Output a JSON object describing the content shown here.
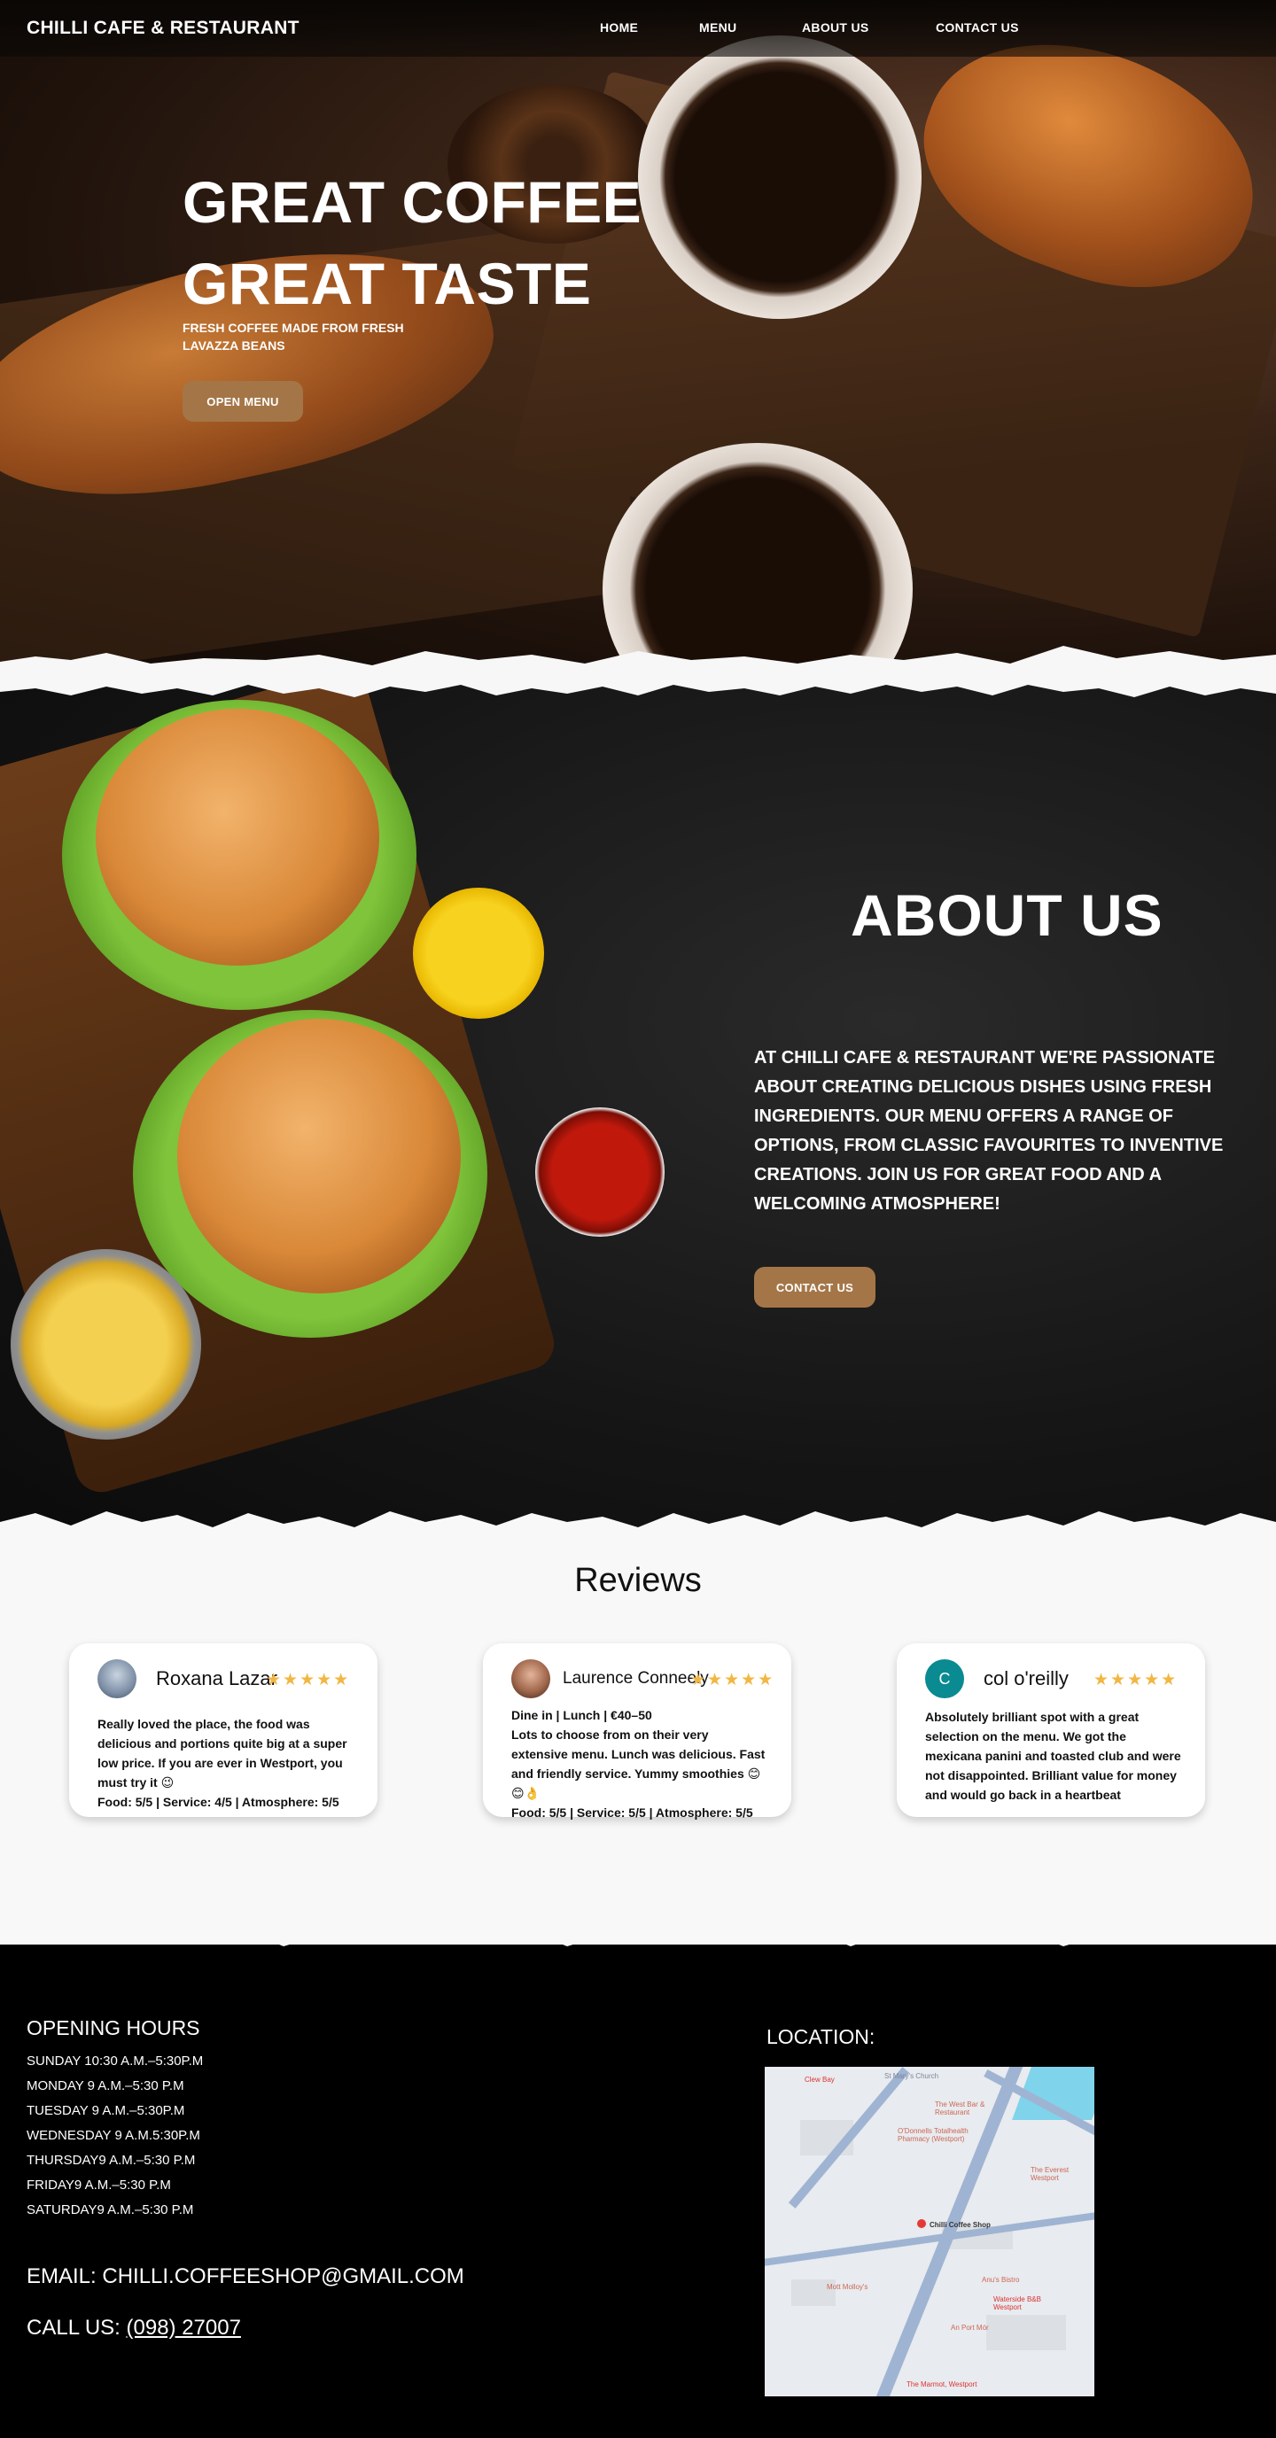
{
  "nav": {
    "brand": "CHILLI CAFE  & RESTAURANT",
    "links": [
      "HOME",
      "MENU",
      "ABOUT US",
      "CONTACT US"
    ]
  },
  "hero": {
    "title_line1": "GREAT COFFEE",
    "title_line2": "GREAT TASTE",
    "subtitle": "FRESH COFFEE MADE FROM FRESH LAVAZZA BEANS",
    "button": "OPEN MENU"
  },
  "about": {
    "title": "ABOUT US",
    "text": "AT CHILLI CAFE & RESTAURANT WE'RE PASSIONATE ABOUT CREATING DELICIOUS DISHES USING FRESH INGREDIENTS. OUR MENU OFFERS A RANGE OF OPTIONS, FROM CLASSIC FAVOURITES TO INVENTIVE CREATIONS. JOIN US FOR GREAT FOOD AND A WELCOMING ATMOSPHERE!",
    "button": "CONTACT US"
  },
  "reviews": {
    "title": "Reviews",
    "items": [
      {
        "name": "Roxana Lazar",
        "stars": "★★★★★",
        "text": "Really loved the place, the food was delicious and portions quite big at a super low price. If you are ever in Westport, you must try it 😉",
        "ratings": "Food: 5/5  |  Service: 4/5  |  Atmosphere: 5/5"
      },
      {
        "name": "Laurence Conneely",
        "stars": "★★★★★",
        "meta": "Dine in  |  Lunch  |  €40–50",
        "text": "Lots to choose from on their very extensive menu. Lunch was delicious. Fast and friendly service. Yummy smoothies 😊😊👌",
        "ratings": "Food: 5/5  |  Service: 5/5  |  Atmosphere: 5/5"
      },
      {
        "name": "col o'reilly",
        "initial": "C",
        "stars": "★★★★★",
        "text": "Absolutely brilliant spot with a great selection on the menu. We got the mexicana panini and toasted club and were not disappointed. Brilliant value for money and would go back in a heartbeat"
      }
    ]
  },
  "footer": {
    "hours_title": "OPENING HOURS",
    "hours": [
      "SUNDAY 10:30 A.M.–5:30P.M",
      "MONDAY 9 A.M.–5:30 P.M",
      "TUESDAY 9 A.M.–5:30P.M",
      "WEDNESDAY 9 A.M.5:30P.M",
      "THURSDAY9 A.M.–5:30 P.M",
      "FRIDAY9 A.M.–5:30 P.M",
      "SATURDAY9 A.M.–5:30 P.M"
    ],
    "email_label": "EMAIL: ",
    "email": "CHILLI.COFFEESHOP@GMAIL.COM",
    "phone_label": "CALL US: ",
    "phone": "(098) 27007",
    "location_title": "LOCATION:",
    "map_labels": {
      "place": "Chilli Coffee Shop",
      "clew_bay": "Clew Bay",
      "marmot": "The Marmot, Westport",
      "west_bar": "The West Bar & Restaurant",
      "pharmacy": "O'Donnells Totalhealth Pharmacy (Westport)",
      "st_marys": "St Mary's Church",
      "mott": "Mott Molloy's",
      "mall": "An Port Mór",
      "everest": "The Everest Westport",
      "waterside": "Waterside B&B Westport",
      "bar": "Anu's Bistro"
    }
  }
}
